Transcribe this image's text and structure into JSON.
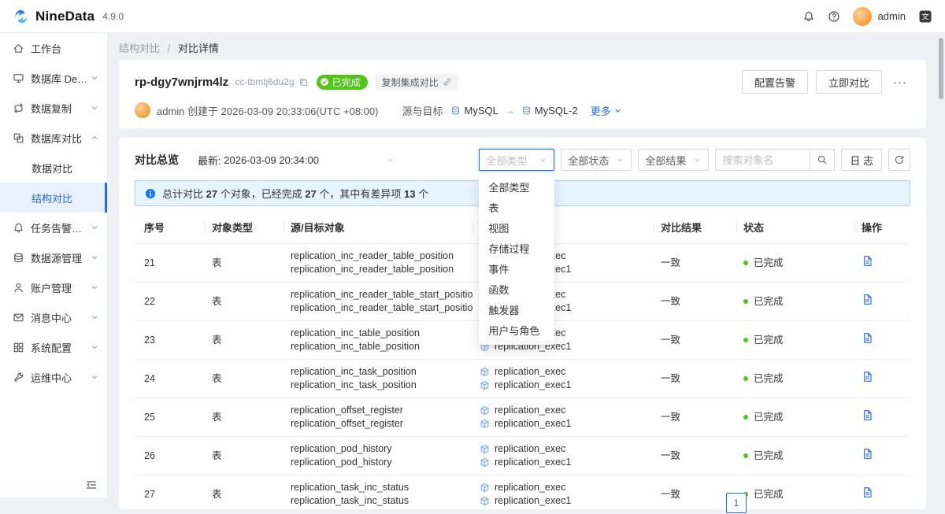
{
  "colors": {
    "accent": "#2468f2",
    "success": "#52c41a",
    "banner_bg": "#e6f4ff"
  },
  "topbar": {
    "brand": "NineData",
    "version": "4.9.0",
    "username": "admin"
  },
  "breadcrumb": {
    "parent": "结构对比",
    "separator": "/",
    "current": "对比详情"
  },
  "sidebar": {
    "items": [
      {
        "label": "工作台",
        "icon": "home",
        "chevron": ""
      },
      {
        "label": "数据库 DevOps",
        "icon": "devops",
        "chevron": "down"
      },
      {
        "label": "数据复制",
        "icon": "replication",
        "chevron": "down"
      },
      {
        "label": "数据库对比",
        "icon": "compare",
        "chevron": "up",
        "children": [
          {
            "label": "数据对比",
            "active": false
          },
          {
            "label": "结构对比",
            "active": true
          }
        ]
      },
      {
        "label": "任务告警管理",
        "icon": "alarm",
        "chevron": "down"
      },
      {
        "label": "数据源管理",
        "icon": "datasource",
        "chevron": "down"
      },
      {
        "label": "账户管理",
        "icon": "account",
        "chevron": "down"
      },
      {
        "label": "消息中心",
        "icon": "message",
        "chevron": "down"
      },
      {
        "label": "系统配置",
        "icon": "system",
        "chevron": "down"
      },
      {
        "label": "运维中心",
        "icon": "ops",
        "chevron": "down"
      }
    ]
  },
  "header": {
    "task_id": "rp-dgy7wnjrm4lz",
    "sub_id": "cc-tbmtj6du2g",
    "status_badge": "已完成",
    "tag": "复制集成对比",
    "creator_line": "admin 创建于 2026-03-09 20:33:06(UTC +08:00)",
    "source_target_label": "源与目标",
    "source": "MySQL",
    "arrow": "→",
    "target": "MySQL-2",
    "more_link": "更多",
    "btn_alert": "配置告警",
    "btn_compare": "立即对比",
    "btn_more": "···"
  },
  "overview": {
    "title": "对比总览",
    "latest_label": "最新:",
    "latest_value": "2026-03-09 20:34:00",
    "filters": {
      "type": "全部类型",
      "status": "全部状态",
      "result": "全部结果"
    },
    "search_placeholder": "搜索对象名",
    "log_label": "日 志",
    "banner": {
      "t1": "总计对比 ",
      "n1": "27",
      "t2": " 个对象，已经完成 ",
      "n2": "27",
      "t3": " 个，其中有差异项 ",
      "n3": "13",
      "t4": " 个"
    }
  },
  "type_dropdown": {
    "options": [
      "全部类型",
      "表",
      "视图",
      "存储过程",
      "事件",
      "函数",
      "触发器",
      "用户与角色"
    ]
  },
  "table": {
    "headers": [
      "序号",
      "对象类型",
      "源/目标对象",
      "",
      "对比结果",
      "状态",
      "操作"
    ],
    "rows": [
      {
        "no": "21",
        "type": "表",
        "src": "replication_inc_reader_table_position",
        "dst": "replication_inc_reader_table_position",
        "db_src": "replication_exec",
        "db_dst": "replication_exec1",
        "result": "一致",
        "status": "已完成"
      },
      {
        "no": "22",
        "type": "表",
        "src": "replication_inc_reader_table_start_position",
        "dst": "replication_inc_reader_table_start_position",
        "db_src": "replication_exec",
        "db_dst": "replication_exec1",
        "result": "一致",
        "status": "已完成"
      },
      {
        "no": "23",
        "type": "表",
        "src": "replication_inc_table_position",
        "dst": "replication_inc_table_position",
        "db_src": "replication_exec",
        "db_dst": "replication_exec1",
        "result": "一致",
        "status": "已完成"
      },
      {
        "no": "24",
        "type": "表",
        "src": "replication_inc_task_position",
        "dst": "replication_inc_task_position",
        "db_src": "replication_exec",
        "db_dst": "replication_exec1",
        "result": "一致",
        "status": "已完成"
      },
      {
        "no": "25",
        "type": "表",
        "src": "replication_offset_register",
        "dst": "replication_offset_register",
        "db_src": "replication_exec",
        "db_dst": "replication_exec1",
        "result": "一致",
        "status": "已完成"
      },
      {
        "no": "26",
        "type": "表",
        "src": "replication_pod_history",
        "dst": "replication_pod_history",
        "db_src": "replication_exec",
        "db_dst": "replication_exec1",
        "result": "一致",
        "status": "已完成"
      },
      {
        "no": "27",
        "type": "表",
        "src": "replication_task_inc_status",
        "dst": "replication_task_inc_status",
        "db_src": "replication_exec",
        "db_dst": "replication_exec1",
        "result": "一致",
        "status": "已完成"
      }
    ]
  },
  "pagination": {
    "page": "1"
  }
}
